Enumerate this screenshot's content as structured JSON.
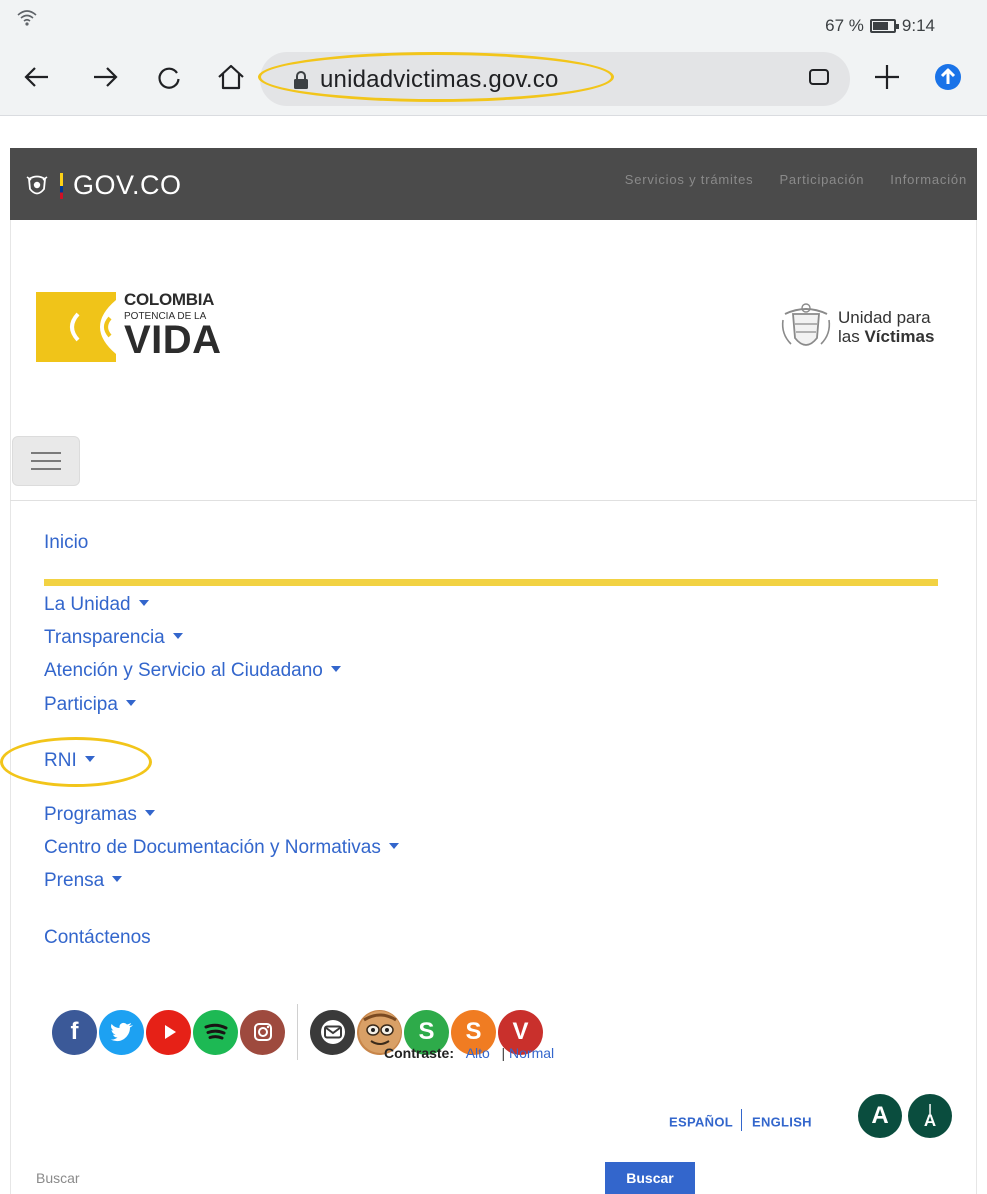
{
  "status_bar": {
    "battery_text": "67 %",
    "battery_level": 0.67,
    "time": "9:14",
    "wifi_icon": "wifi-icon"
  },
  "browser": {
    "url": "unidadvictimas.gov.co",
    "icons": [
      "back-arrow-icon",
      "forward-arrow-icon",
      "reload-icon",
      "home-icon",
      "lock-icon",
      "tab-switcher-icon",
      "new-tab-icon",
      "update-icon"
    ],
    "highlight_color": "#f2c51a"
  },
  "govbar": {
    "brand": "GOV.CO",
    "nav": [
      "Servicios y trámites",
      "Participación",
      "Información"
    ]
  },
  "logos": {
    "colombia": {
      "line1": "COLOMBIA",
      "line2": "POTENCIA DE LA",
      "line3": "VIDA"
    },
    "unidad": {
      "line1": "Unidad para",
      "line2_prefix": "las ",
      "line2_bold": "Víctimas"
    }
  },
  "menu": {
    "items": [
      {
        "label": "Inicio",
        "dropdown": false
      },
      {
        "label": "La Unidad",
        "dropdown": true
      },
      {
        "label": "Transparencia",
        "dropdown": true
      },
      {
        "label": "Atención y Servicio al Ciudadano",
        "dropdown": true
      },
      {
        "label": "Participa",
        "dropdown": true
      },
      {
        "label": "RNI",
        "dropdown": true
      },
      {
        "label": "Programas",
        "dropdown": true
      },
      {
        "label": "Centro de Documentación y Normativas",
        "dropdown": true
      },
      {
        "label": "Prensa",
        "dropdown": true
      },
      {
        "label": "Contáctenos",
        "dropdown": false
      }
    ],
    "link_color": "#3366cc",
    "accent_bar_color": "#f2d243"
  },
  "social": {
    "icons": [
      "facebook-icon",
      "twitter-icon",
      "youtube-icon",
      "spotify-icon",
      "instagram-icon",
      "email-icon",
      "mascot-icon",
      "s-icon",
      "s-orange-icon",
      "v-icon"
    ],
    "letters": {
      "facebook": "f",
      "s": "S",
      "s2": "S",
      "v": "V"
    }
  },
  "contrast": {
    "label": "Contraste:",
    "high": "Alto",
    "normal": "Normal",
    "sep": "|"
  },
  "language": {
    "es": "ESPAÑOL",
    "en": "ENGLISH"
  },
  "accessibility": {
    "a1": "A",
    "a2": "A"
  },
  "search": {
    "label": "Buscar",
    "button": "Buscar"
  }
}
